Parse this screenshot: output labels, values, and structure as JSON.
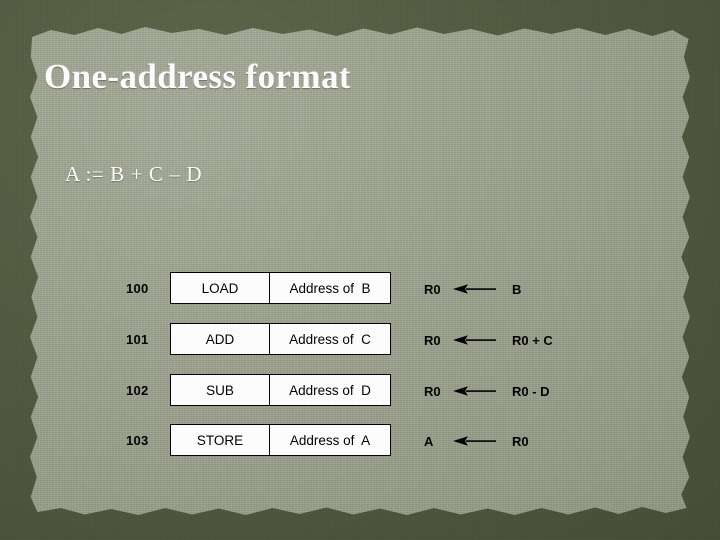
{
  "slide": {
    "title": "One-address format",
    "expression": "A := B + C – D",
    "background_outer_color": "#4e553c",
    "paper_color": "#9ba08d",
    "text_color": "#ffffff",
    "box_fill_color": "#ffffff",
    "box_border_color": "#000000"
  },
  "table": {
    "rows": [
      {
        "address": "100",
        "opcode": "LOAD",
        "operand": "Address of  B",
        "micro_dest": "R0",
        "micro_arrow": "left-arrow-icon",
        "micro_src": "B"
      },
      {
        "address": "101",
        "opcode": "ADD",
        "operand": "Address of  C",
        "micro_dest": "R0",
        "micro_arrow": "left-arrow-icon",
        "micro_src": "R0 + C"
      },
      {
        "address": "102",
        "opcode": "SUB",
        "operand": "Address of  D",
        "micro_dest": "R0",
        "micro_arrow": "left-arrow-icon",
        "micro_src": "R0 - D"
      },
      {
        "address": "103",
        "opcode": "STORE",
        "operand": "Address of  A",
        "micro_dest": "A",
        "micro_arrow": "left-arrow-icon",
        "micro_src": "R0"
      }
    ]
  }
}
